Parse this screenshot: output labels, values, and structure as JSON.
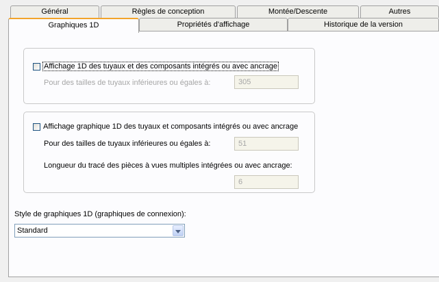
{
  "tabs": {
    "row1": [
      {
        "label": "Général"
      },
      {
        "label": "Règles de conception"
      },
      {
        "label": "Montée/Descente"
      },
      {
        "label": "Autres"
      }
    ],
    "row2": [
      {
        "label": "Graphiques 1D",
        "active": true
      },
      {
        "label": "Propriétés d'affichage"
      },
      {
        "label": "Historique de la version"
      }
    ]
  },
  "group1": {
    "checkbox_label": "Affichage 1D des tuyaux et des composants intégrés ou avec ancrage",
    "checked": false,
    "size_label": "Pour des tailles de tuyaux inférieures ou égales à:",
    "size_value": "305"
  },
  "group2": {
    "checkbox_label": "Affichage graphique 1D des tuyaux et composants intégrés ou avec ancrage",
    "checked": false,
    "size_label": "Pour des tailles de tuyaux inférieures ou égales à:",
    "size_value": "51",
    "length_label": "Longueur du tracé des pièces à vues multiples intégrées ou avec ancrage:",
    "length_value": "6"
  },
  "style": {
    "label": "Style de graphiques 1D (graphiques de connexion):",
    "selected_value": "Standard"
  },
  "colors": {
    "window_background": "#f0f0f0",
    "panel_background": "#fcfcfe",
    "active_tab_accent": "#f2a42a",
    "disabled_text": "#a6a6a6",
    "checkbox_border": "#1c5180"
  }
}
